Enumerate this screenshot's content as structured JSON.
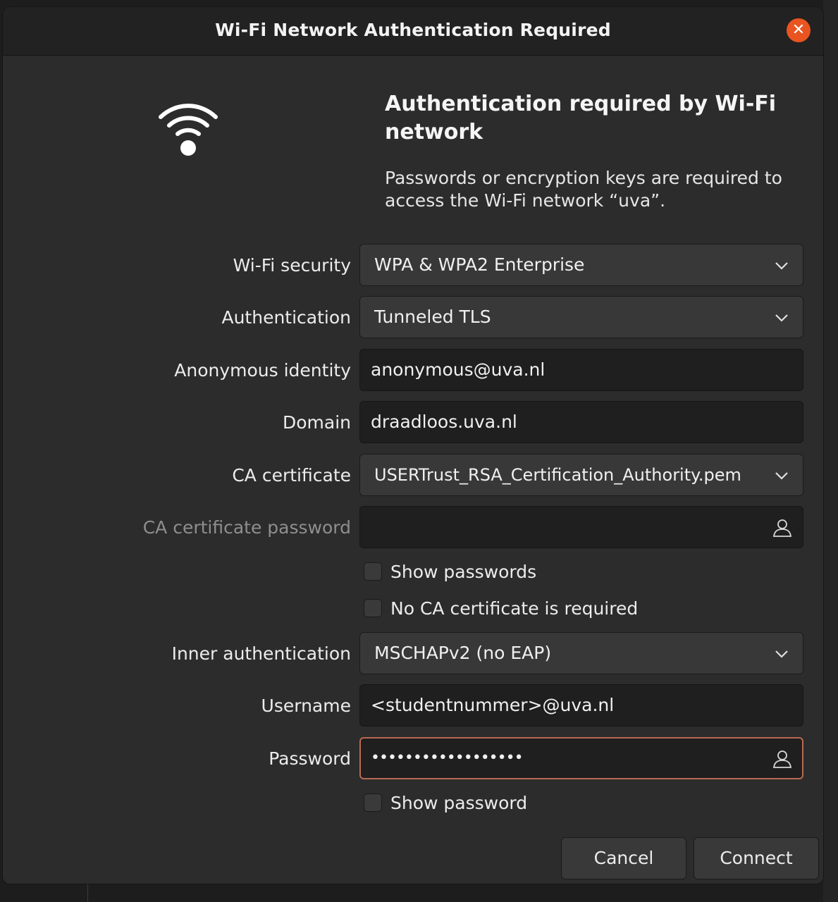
{
  "window": {
    "title": "Wi-Fi Network Authentication Required",
    "close_icon": "close-icon"
  },
  "header": {
    "icon": "wifi-icon",
    "heading": "Authentication required by Wi-Fi network",
    "description": "Passwords or encryption keys are required to access the Wi-Fi network “uva”."
  },
  "form": {
    "wifi_security": {
      "label": "Wi-Fi security",
      "value": "WPA & WPA2 Enterprise"
    },
    "authentication": {
      "label": "Authentication",
      "value": "Tunneled TLS"
    },
    "anonymous_identity": {
      "label": "Anonymous identity",
      "value": "anonymous@uva.nl"
    },
    "domain": {
      "label": "Domain",
      "value": "draadloos.uva.nl"
    },
    "ca_certificate": {
      "label": "CA certificate",
      "value": "USERTrust_RSA_Certification_Authority.pem"
    },
    "ca_certificate_password": {
      "label": "CA certificate password",
      "value": ""
    },
    "show_passwords": {
      "label": "Show passwords",
      "checked": false
    },
    "no_ca_required": {
      "label": "No CA certificate is required",
      "checked": false
    },
    "inner_authentication": {
      "label": "Inner authentication",
      "value": "MSCHAPv2 (no EAP)"
    },
    "username": {
      "label": "Username",
      "value": "<studentnummer>@uva.nl"
    },
    "password": {
      "label": "Password",
      "value": "••••••••••••••••••"
    },
    "show_password": {
      "label": "Show password",
      "checked": false
    }
  },
  "buttons": {
    "cancel": "Cancel",
    "connect": "Connect"
  },
  "colors": {
    "accent": "#e95420",
    "focus_border": "#b86a53",
    "dialog_bg": "#2c2c2c",
    "titlebar_bg": "#222222"
  }
}
